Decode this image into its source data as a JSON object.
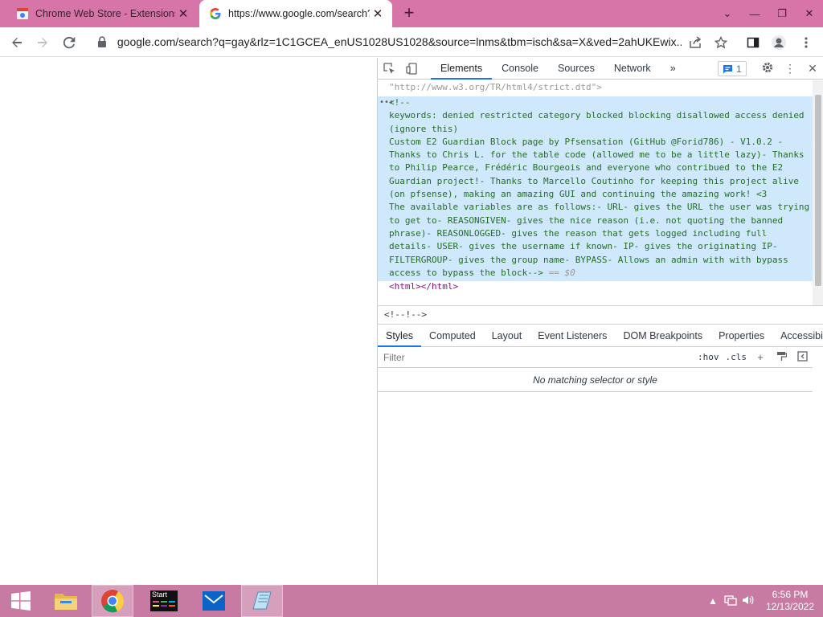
{
  "browser": {
    "tabs": [
      {
        "title": "Chrome Web Store - Extensions",
        "active": false
      },
      {
        "title": "https://www.google.com/search?",
        "active": true
      }
    ],
    "new_tab": "+",
    "window_controls": {
      "chevron": "⌄",
      "minimize": "—",
      "restore": "❐",
      "close": "✕"
    },
    "url": "google.com/search?q=gay&rlz=1C1GCEA_enUS1028US1028&source=lnms&tbm=isch&sa=X&ved=2ahUKEwix..."
  },
  "devtools": {
    "tabs": [
      "Elements",
      "Console",
      "Sources",
      "Network"
    ],
    "more": "»",
    "issues_count": "1",
    "doctype_tail": "\"http://www.w3.org/TR/html4/strict.dtd\">",
    "comment_lines": [
      "<!--",
      "keywords: denied restricted category blocked blocking disallowed access denied (ignore this)",
      "Custom E2 Guardian Block page by Pfsensation (GitHub @Forid786) - V1.0.2 - Thanks to Chris L. for the table code (allowed me to be a little lazy)- Thanks to Philip Pearce, Frédéric Bourgeois and everyone who contribued to the E2 Guardian project!- Thanks to Marcello Coutinho for keeping this project alive (on pfsense), making an amazing GUI and continuing the amazing work! <3",
      "The available variables are as follows:- URL- gives the URL the user was trying to get to- REASONGIVEN- gives the nice reason (i.e. not quoting the banned phrase)- REASONLOGGED- gives the reason that gets logged including full details- USER- gives the username if known- IP- gives the originating IP- FILTERGROUP- gives the group name- BYPASS- Allows an admin with with bypass access to bypass the block-->"
    ],
    "eq0": "== $0",
    "html_tag": "<html></html>",
    "breadcrumb": "<!--!-->",
    "sub_tabs": [
      "Styles",
      "Computed",
      "Layout",
      "Event Listeners",
      "DOM Breakpoints",
      "Properties",
      "Accessibility"
    ],
    "filter_placeholder": "Filter",
    "hov": ":hov",
    "cls": ".cls",
    "no_match": "No matching selector or style"
  },
  "taskbar": {
    "start_label": "Start",
    "time": "6:56 PM",
    "date": "12/13/2022"
  }
}
